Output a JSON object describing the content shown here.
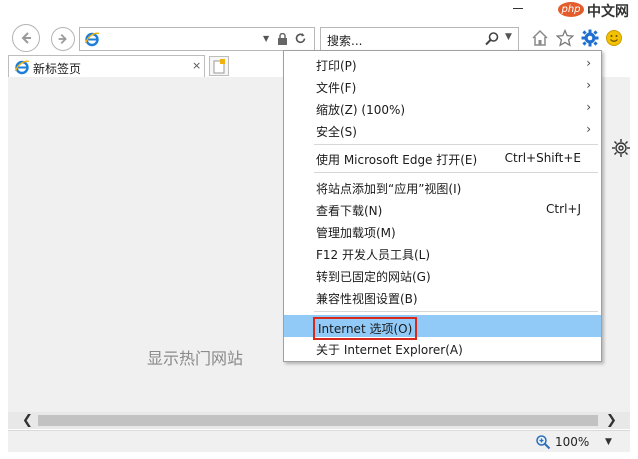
{
  "window": {
    "watermark_logo": "php",
    "watermark_text": "中文网"
  },
  "navigation": {
    "address_value": "",
    "search_placeholder": "搜索..."
  },
  "tab": {
    "title": "新标签页",
    "close_symbol": "×"
  },
  "content": {
    "hot_sites_text": "显示热门网站"
  },
  "statusbar": {
    "zoom": "100%"
  },
  "menu": {
    "items": [
      {
        "label": "打印(P)",
        "shortcut": "",
        "submenu": true
      },
      {
        "label": "文件(F)",
        "shortcut": "",
        "submenu": true
      },
      {
        "label": "缩放(Z) (100%)",
        "shortcut": "",
        "submenu": true
      },
      {
        "label": "安全(S)",
        "shortcut": "",
        "submenu": true
      },
      {
        "label": "使用 Microsoft Edge 打开(E)",
        "shortcut": "Ctrl+Shift+E",
        "submenu": false
      },
      {
        "label": "将站点添加到“应用”视图(I)",
        "shortcut": "",
        "submenu": false
      },
      {
        "label": "查看下载(N)",
        "shortcut": "Ctrl+J",
        "submenu": false
      },
      {
        "label": "管理加载项(M)",
        "shortcut": "",
        "submenu": false
      },
      {
        "label": "F12 开发人员工具(L)",
        "shortcut": "",
        "submenu": false
      },
      {
        "label": "转到已固定的网站(G)",
        "shortcut": "",
        "submenu": false
      },
      {
        "label": "兼容性视图设置(B)",
        "shortcut": "",
        "submenu": false
      },
      {
        "label": "Internet 选项(O)",
        "shortcut": "",
        "submenu": false,
        "highlighted": true
      },
      {
        "label": "关于 Internet Explorer(A)",
        "shortcut": "",
        "submenu": false
      }
    ]
  },
  "colors": {
    "menu_highlight": "#91c9f7",
    "highlight_border": "#d9291c",
    "ie_blue": "#1e7fd6",
    "favorites_star": "#7a7a7a",
    "smiley": "#f2c200"
  }
}
